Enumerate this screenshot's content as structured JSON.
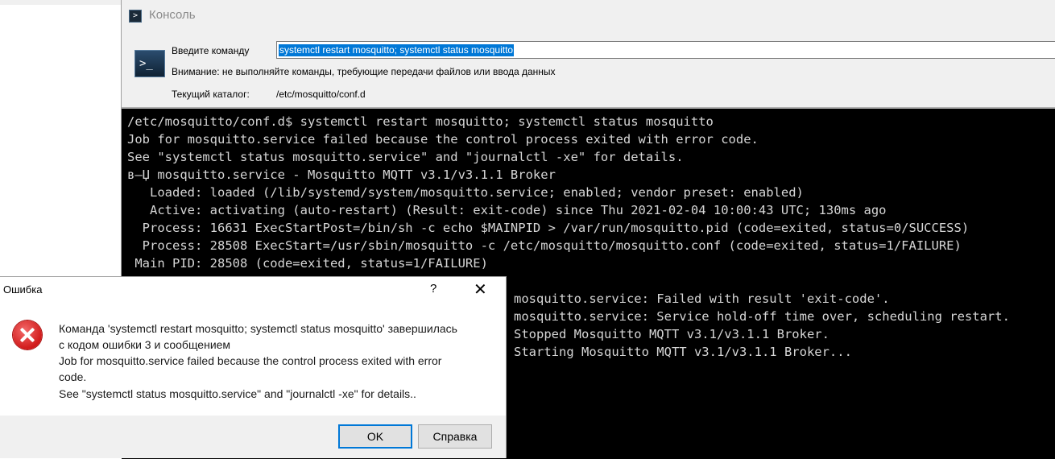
{
  "console": {
    "title": "Консоль",
    "command_label": "Введите команду",
    "command_value": "systemctl restart mosquitto; systemctl status mosquitto",
    "warning": "Внимание: не выполняйте команды, требующие передачи файлов или ввода данных",
    "cwd_label": "Текущий каталог:",
    "cwd_value": "/etc/mosquitto/conf.d"
  },
  "terminal": {
    "lines": [
      "/etc/mosquitto/conf.d$ systemctl restart mosquitto; systemctl status mosquitto",
      "Job for mosquitto.service failed because the control process exited with error code.",
      "See \"systemctl status mosquitto.service\" and \"journalctl -xe\" for details.",
      "в—Џ mosquitto.service - Mosquitto MQTT v3.1/v3.1.1 Broker",
      "   Loaded: loaded (/lib/systemd/system/mosquitto.service; enabled; vendor preset: enabled)",
      "   Active: activating (auto-restart) (Result: exit-code) since Thu 2021-02-04 10:00:43 UTC; 130ms ago",
      "  Process: 16631 ExecStartPost=/bin/sh -c echo $MAINPID > /var/run/mosquitto.pid (code=exited, status=0/SUCCESS)",
      "  Process: 28508 ExecStart=/usr/sbin/mosquitto -c /etc/mosquitto/mosquitto.conf (code=exited, status=1/FAILURE)",
      " Main PID: 28508 (code=exited, status=1/FAILURE)"
    ],
    "tail_lines": [
      "mosquitto.service: Failed with result 'exit-code'.",
      "mosquitto.service: Service hold-off time over, scheduling restart.",
      "Stopped Mosquitto MQTT v3.1/v3.1.1 Broker.",
      "Starting Mosquitto MQTT v3.1/v3.1.1 Broker..."
    ]
  },
  "dialog": {
    "title": "Ошибка",
    "help_glyph": "?",
    "close_glyph": "✕",
    "icon": "error-icon",
    "message_lines": [
      "Команда 'systemctl restart mosquitto; systemctl status mosquitto' завершилась",
      "с кодом ошибки 3 и сообщением",
      "Job for mosquitto.service failed because the control process exited with error",
      "code.",
      "See \"systemctl status mosquitto.service\" and \"journalctl -xe\" for details.."
    ],
    "ok_label": "OK",
    "help_label": "Справка"
  },
  "colors": {
    "selection": "#0078d7",
    "terminal_bg": "#000000",
    "terminal_fg": "#d6d6d6",
    "error_red": "#d11a1a"
  }
}
